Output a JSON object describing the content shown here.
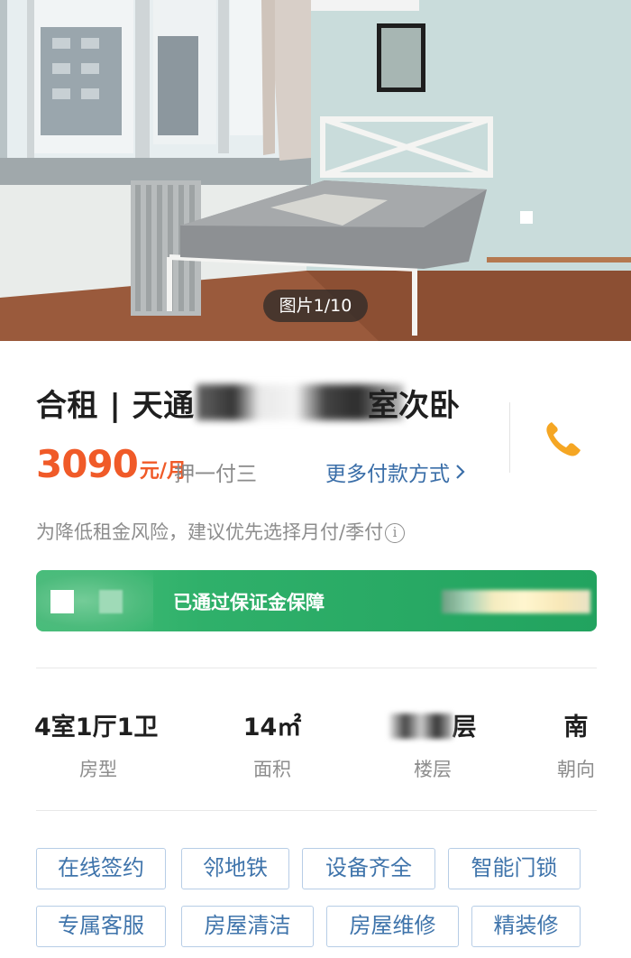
{
  "gallery": {
    "counter": "图片1/10"
  },
  "listing": {
    "title_prefix": "合租 | 天通",
    "title_suffix": "室次卧",
    "price": "3090",
    "price_unit": "元/月",
    "deposit": "押一付三",
    "more_payment": "更多付款方式",
    "tip": "为降低租金风险，建议优先选择月付/季付",
    "info_glyph": "i"
  },
  "banner": {
    "text": "已通过保证金保障"
  },
  "stats": [
    {
      "value": "4室1厅1卫",
      "label": "房型"
    },
    {
      "value": "14㎡",
      "label": "面积"
    },
    {
      "value": "层",
      "label": "楼层"
    },
    {
      "value": "南",
      "label": "朝向"
    }
  ],
  "tags": [
    "在线签约",
    "邻地铁",
    "设备齐全",
    "智能门锁",
    "专属客服",
    "房屋清洁",
    "房屋维修",
    "精装修"
  ],
  "colors": {
    "accent_price": "#f05a28",
    "link": "#3a6ea8",
    "banner": "#2fb06a",
    "phone": "#f5a623",
    "tag_border": "#b7cde6"
  },
  "icons": {
    "phone": "phone-icon",
    "chevron": "chevron-right-icon",
    "info": "info-icon"
  }
}
